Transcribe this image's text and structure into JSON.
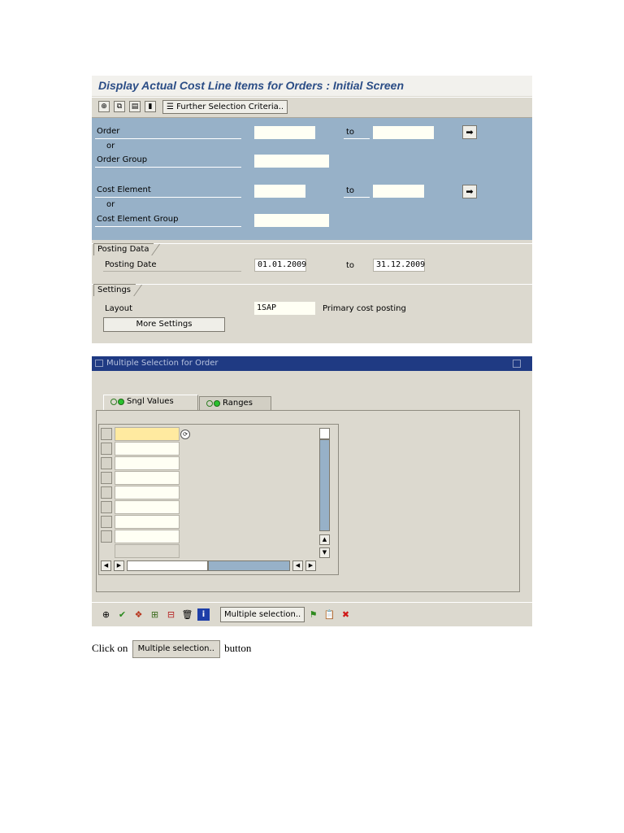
{
  "screen1": {
    "title": "Display Actual Cost Line Items for Orders : Initial Screen",
    "toolbar": {
      "further_label": "Further Selection Criteria..",
      "icons": [
        "execute-icon",
        "variant-icon",
        "save-variant-icon",
        "info-icon",
        "selection-list-icon"
      ]
    },
    "fields": {
      "order": "Order",
      "or1": "or",
      "order_group": "Order Group",
      "cost_element": "Cost Element",
      "or2": "or",
      "cost_element_group": "Cost Element Group",
      "to1": "to",
      "to2": "to"
    },
    "posting": {
      "group_title": "Posting Data",
      "label": "Posting Date",
      "from": "01.01.2009",
      "to_label": "to",
      "to": "31.12.2009"
    },
    "settings": {
      "group_title": "Settings",
      "layout_label": "Layout",
      "layout_value": "1SAP",
      "layout_desc": "Primary cost posting",
      "more_label": "More Settings"
    }
  },
  "screen2": {
    "title": "Multiple Selection for Order",
    "tabs": [
      {
        "label": "Sngl Values"
      },
      {
        "label": "Ranges"
      }
    ],
    "toolbar": {
      "multiple_label": "Multiple selection.."
    }
  },
  "caption": {
    "before": "Click on",
    "button": "Multiple selection..",
    "after": "button"
  },
  "colors": {
    "title_blue": "#2b4d86",
    "panel_gray": "#dcd9cf",
    "selection_blue": "#97b1c8",
    "dialog_title": "#1f3a83"
  }
}
